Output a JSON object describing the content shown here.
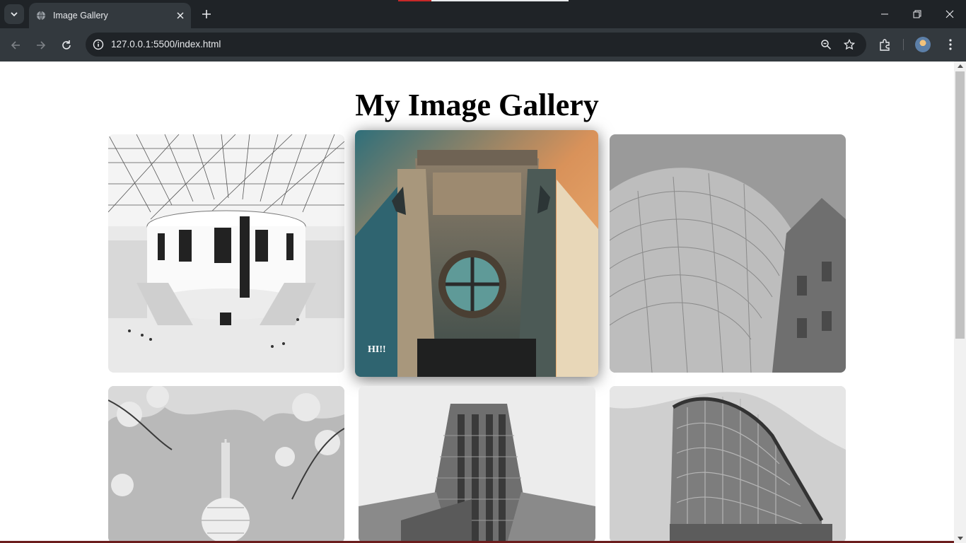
{
  "browser": {
    "tab_title": "Image Gallery",
    "url": "127.0.0.1:5500/index.html"
  },
  "page": {
    "heading": "My Image Gallery",
    "images": [
      {
        "name": "british-museum-great-court",
        "filter": "grayscale",
        "caption": ""
      },
      {
        "name": "building-round-window",
        "filter": "color",
        "caption": "HI!!"
      },
      {
        "name": "curved-metal-facade",
        "filter": "grayscale",
        "caption": ""
      },
      {
        "name": "tv-tower-with-blossoms",
        "filter": "grayscale",
        "caption": ""
      },
      {
        "name": "tall-residential-tower",
        "filter": "grayscale",
        "caption": ""
      },
      {
        "name": "curved-glass-office",
        "filter": "grayscale",
        "caption": ""
      }
    ]
  },
  "colors": {
    "tabbar_bg": "#1f2327",
    "toolbar_bg": "#33393e",
    "omnibox_bg": "#1f2327",
    "page_bg": "#ffffff"
  },
  "icons": [
    "tab-list-icon",
    "globe-icon",
    "close-icon",
    "plus-icon",
    "minimize-icon",
    "restore-icon",
    "window-close-icon",
    "back-arrow-icon",
    "forward-arrow-icon",
    "reload-icon",
    "site-info-icon",
    "zoom-icon",
    "star-icon",
    "extensions-icon",
    "profile-avatar",
    "more-menu-icon"
  ]
}
